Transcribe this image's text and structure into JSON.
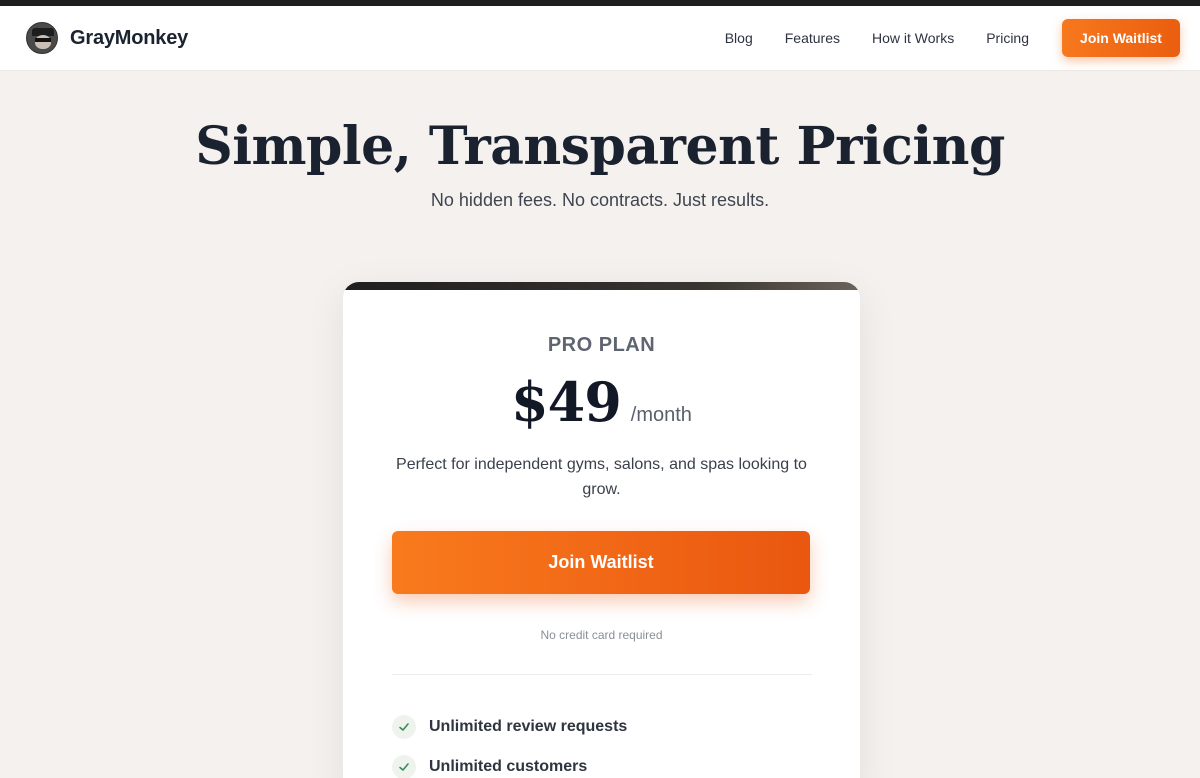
{
  "navbar": {
    "brand_name": "GrayMonkey",
    "links": [
      "Blog",
      "Features",
      "How it Works",
      "Pricing"
    ],
    "cta_label": "Join Waitlist"
  },
  "hero": {
    "title": "Simple, Transparent Pricing",
    "subtitle": "No hidden fees. No contracts. Just results."
  },
  "plan": {
    "name": "PRO PLAN",
    "price": "$49",
    "period": "/month",
    "description": "Perfect for independent gyms, salons, and spas looking to grow.",
    "cta_label": "Join Waitlist",
    "note": "No credit card required",
    "features": [
      "Unlimited review requests",
      "Unlimited customers"
    ]
  },
  "colors": {
    "accent": "#f77a1d",
    "background": "#f4f1ee",
    "check": "#3d8b5a"
  }
}
